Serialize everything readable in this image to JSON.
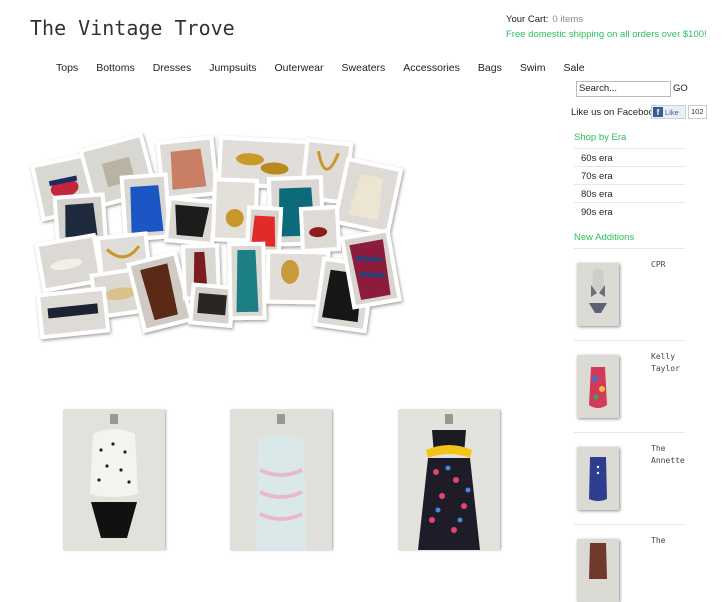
{
  "site": {
    "title": "The Vintage Trove"
  },
  "cart": {
    "label": "Your Cart:",
    "count": "0 items"
  },
  "shipping_note": "Free domestic shipping on all orders over $100!",
  "nav": [
    "Tops",
    "Bottoms",
    "Dresses",
    "Jumpsuits",
    "Outerwear",
    "Sweaters",
    "Accessories",
    "Bags",
    "Swim",
    "Sale"
  ],
  "search": {
    "value": "Search...",
    "go_label": "GO"
  },
  "facebook": {
    "label": "Like us on Facebook",
    "button": "Like",
    "count": "102"
  },
  "shop_by_era": {
    "title": "Shop by Era",
    "items": [
      "60s era",
      "70s era",
      "80s era",
      "90s era"
    ]
  },
  "new_additions": {
    "title": "New Additions",
    "items": [
      {
        "name_line1": "CPR",
        "name_line2": ""
      },
      {
        "name_line1": "Kelly",
        "name_line2": "Taylor"
      },
      {
        "name_line1": "The",
        "name_line2": "Annette"
      },
      {
        "name_line1": "The",
        "name_line2": ""
      }
    ]
  },
  "colors": {
    "accent_green": "#2bbf5a",
    "text": "#222222",
    "muted": "#888888"
  }
}
